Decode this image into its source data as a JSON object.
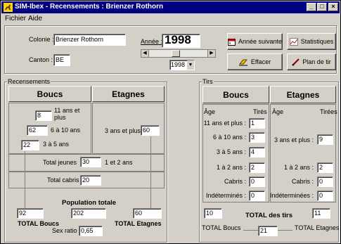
{
  "window": {
    "title": "SIM-Ibex - Recensements : Brienzer Rothorn",
    "controls": [
      "_",
      "□",
      "×"
    ]
  },
  "menu": [
    "Fichier",
    "Aide"
  ],
  "colonie": {
    "label": "Colonie :",
    "value": "Brienzer Rothorn"
  },
  "canton": {
    "label": "Canton :",
    "value": "BE"
  },
  "annee": {
    "label": "Année :",
    "value": "1998",
    "select_value": "1998",
    "scroll_level": 0.45
  },
  "buttons": {
    "annee_suivante": "Année suivante",
    "statistiques": "Statistiques",
    "effacer": "Effacer",
    "plan_de_tir": "Plan de tir"
  },
  "recensements": {
    "title": "Recensements",
    "boucs_header": "Boucs",
    "etagnes_header": "Etagnes",
    "rows": [
      {
        "label": "11 ans et plus",
        "value": "8"
      },
      {
        "label": "6 à 10 ans",
        "value": "62"
      },
      {
        "label": "3 à 5 ans",
        "value": "22"
      }
    ],
    "etagnes_label": "3 ans et plus",
    "etagnes_value": "60",
    "total_jeunes_label": "Total jeunes",
    "total_jeunes_value": "30",
    "ages_1_2_label": "1 et 2 ans",
    "total_cabris_label": "Total cabris",
    "total_cabris_value": "20",
    "population_label": "Population totale",
    "total_boucs_value": "92",
    "population_value": "202",
    "total_etagnes_value": "60",
    "total_boucs_label": "TOTAL Boucs",
    "total_etagnes_label": "TOTAL Etagnes",
    "sex_ratio_label": "Sex ratio :",
    "sex_ratio_value": "0,65"
  },
  "tirs": {
    "title": "Tirs",
    "boucs_header": "Boucs",
    "etagnes_header": "Etagnes",
    "col_age": "Âge",
    "col_tires": "Tirés",
    "col_age2": "Âge",
    "col_tirees": "Tirées",
    "boucs_rows": [
      {
        "label": "11 ans et plus :",
        "value": "1"
      },
      {
        "label": "6 à 10 ans :",
        "value": "3"
      },
      {
        "label": "3 à 5 ans :",
        "value": "4"
      },
      {
        "label": "1 à 2 ans :",
        "value": "2"
      },
      {
        "label": "Cabris :",
        "value": "0"
      },
      {
        "label": "Indéterminés :",
        "value": "0"
      }
    ],
    "etagnes_rows": [
      {
        "label": "3 ans et plus :",
        "value": "9"
      },
      {
        "label": "1 à 2 ans :",
        "value": "2"
      },
      {
        "label": "Cabris :",
        "value": "0"
      },
      {
        "label": "Indéterminées :",
        "value": "0"
      }
    ],
    "total_boucs_value": "10",
    "total_tirs_label": "TOTAL des tirs",
    "total_etagnes_value": "11",
    "total_boucs_label": "TOTAL Boucs",
    "total_etagnes_label": "TOTAL Etagnes",
    "total_value": "21"
  }
}
